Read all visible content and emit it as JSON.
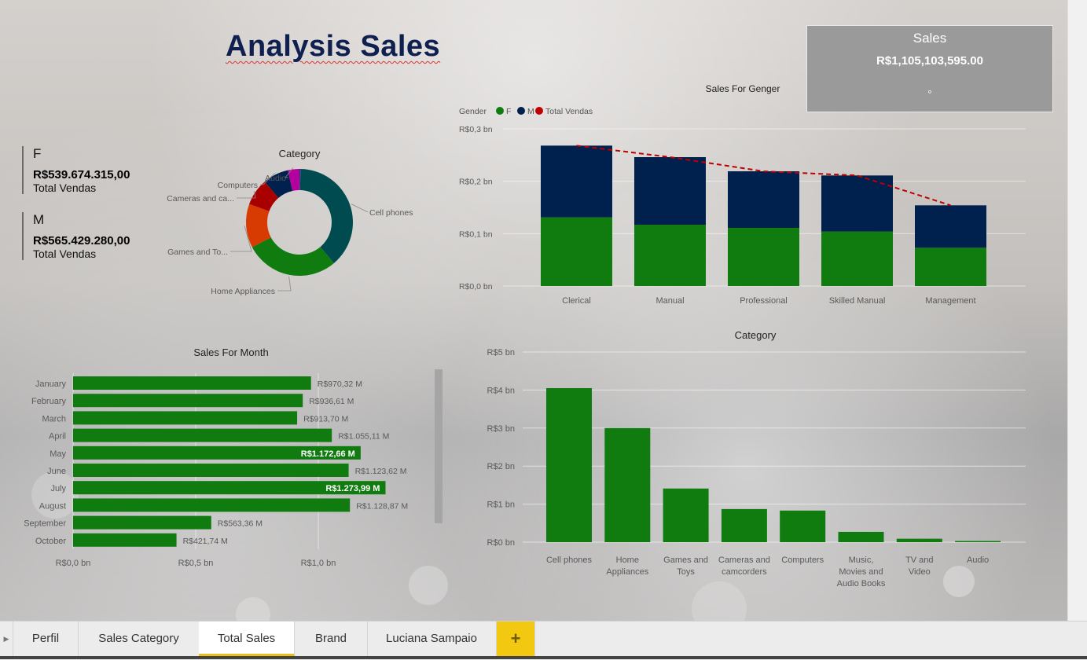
{
  "report_title": "Analysis Sales",
  "sales_card": {
    "title": "Sales",
    "value": "R$1,105,103,595.00",
    "marker": "°"
  },
  "kpis": [
    {
      "label": "F",
      "value": "R$539.674.315,00",
      "caption": "Total Vendas"
    },
    {
      "label": "M",
      "value": "R$565.429.280,00",
      "caption": "Total Vendas"
    }
  ],
  "tabs": [
    {
      "label": "Perfil",
      "active": false
    },
    {
      "label": "Sales Category",
      "active": false
    },
    {
      "label": "Total Sales",
      "active": true
    },
    {
      "label": "Brand",
      "active": false
    },
    {
      "label": "Luciana Sampaio",
      "active": false
    }
  ],
  "add_tab_label": "+",
  "scroll_left_glyph": "▶",
  "colors": {
    "green": "#107c10",
    "navy": "#00204e",
    "red": "#c00000",
    "orange": "#d83b01",
    "teal": "#004b50",
    "magenta": "#b4009e"
  },
  "chart_data": [
    {
      "type": "pie",
      "title": "Category",
      "donut": true,
      "slices": [
        {
          "label": "Cell phones",
          "value": 4.06,
          "color": "#004b50"
        },
        {
          "label": "Home Appliances",
          "value": 3.0,
          "color": "#107c10"
        },
        {
          "label": "Games and To...",
          "value": 1.4,
          "color": "#d83b01"
        },
        {
          "label": "Cameras and ca...",
          "value": 0.86,
          "color": "#a80000"
        },
        {
          "label": "Computers",
          "value": 0.82,
          "color": "#00204e"
        },
        {
          "label": "Audio",
          "value": 0.34,
          "color": "#b4009e"
        },
        {
          "label": "",
          "value": 0.06,
          "color": "#6b1b8f"
        }
      ]
    },
    {
      "type": "bar",
      "stacked": true,
      "title": "Sales For Genger",
      "legend_title": "Gender",
      "legend": [
        {
          "name": "F",
          "color": "#107c10"
        },
        {
          "name": "M",
          "color": "#00204e"
        },
        {
          "name": "Total Vendas",
          "color": "#c00000"
        }
      ],
      "categories": [
        "Clerical",
        "Manual",
        "Professional",
        "Skilled Manual",
        "Management"
      ],
      "series": [
        {
          "name": "F",
          "values": [
            0.131,
            0.117,
            0.111,
            0.104,
            0.073
          ]
        },
        {
          "name": "M",
          "values": [
            0.137,
            0.129,
            0.108,
            0.107,
            0.081
          ]
        },
        {
          "name": "Total Vendas",
          "type": "line",
          "values": [
            0.268,
            0.246,
            0.219,
            0.211,
            0.154
          ]
        }
      ],
      "yticks": [
        "R$0,0 bn",
        "R$0,1 bn",
        "R$0,2 bn",
        "R$0,3 bn"
      ],
      "ylim": [
        0,
        0.3
      ]
    },
    {
      "type": "bar",
      "orientation": "horizontal",
      "title": "Sales For Month",
      "categories": [
        "January",
        "February",
        "March",
        "April",
        "May",
        "June",
        "July",
        "August",
        "September",
        "October"
      ],
      "values": [
        0.97032,
        0.93661,
        0.9137,
        1.05511,
        1.17266,
        1.12362,
        1.27399,
        1.12887,
        0.56336,
        0.42174
      ],
      "data_labels": [
        "R$970,32 M",
        "R$936,61 M",
        "R$913,70 M",
        "R$1.055,11 M",
        "R$1.172,66 M",
        "R$1.123,62 M",
        "R$1.273,99 M",
        "R$1.128,87 M",
        "R$563,36 M",
        "R$421,74 M"
      ],
      "label_inside": [
        false,
        false,
        false,
        false,
        true,
        false,
        true,
        false,
        false,
        false
      ],
      "xticks": [
        "R$0,0 bn",
        "R$0,5 bn",
        "R$1,0 bn"
      ],
      "xlim": [
        0,
        1.3
      ]
    },
    {
      "type": "bar",
      "title": "Category",
      "categories": [
        [
          "Cell phones"
        ],
        [
          "Home",
          "Appliances"
        ],
        [
          "Games and",
          "Toys"
        ],
        [
          "Cameras and",
          "camcorders"
        ],
        [
          "Computers"
        ],
        [
          "Music,",
          "Movies and",
          "Audio Books"
        ],
        [
          "TV and",
          "Video"
        ],
        [
          "Audio"
        ]
      ],
      "values": [
        4.05,
        3.0,
        1.41,
        0.87,
        0.83,
        0.27,
        0.09,
        0.03
      ],
      "yticks": [
        "R$0 bn",
        "R$1 bn",
        "R$2 bn",
        "R$3 bn",
        "R$4 bn",
        "R$5 bn"
      ],
      "ylim": [
        0,
        5
      ]
    }
  ]
}
